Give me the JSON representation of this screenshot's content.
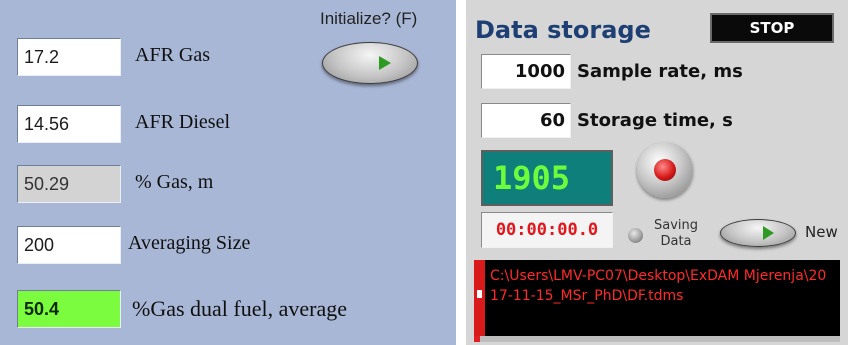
{
  "left": {
    "initialize_label": "Initialize? (F)",
    "afr_gas": {
      "value": "17.2",
      "label": "AFR Gas"
    },
    "afr_diesel": {
      "value": "14.56",
      "label": "AFR Diesel"
    },
    "gas_m": {
      "value": "50.29",
      "label": "% Gas, m"
    },
    "averaging_size": {
      "value": "200",
      "label": "Averaging Size"
    },
    "gas_dual_fuel_avg": {
      "value": "50.4",
      "label": "%Gas dual fuel, average"
    }
  },
  "right": {
    "title": "Data storage",
    "stop_label": "STOP",
    "sample_rate": {
      "value": "1000",
      "label": "Sample rate, ms"
    },
    "storage_time": {
      "value": "60",
      "label": "Storage time, s"
    },
    "counter": "1905",
    "timer": "00:00:00.0",
    "saving_label_line1": "Saving",
    "saving_label_line2": "Data",
    "new_label": "New",
    "file_path": "C:\\Users\\LMV-PC07\\Desktop\\ExDAM Mjerenja\\2017-11-15_MSr_PhD\\DF.tdms"
  },
  "colors": {
    "left_panel_bg": "#a9b7d6",
    "right_panel_bg": "#d6d6d6",
    "title_blue": "#1e3f73",
    "counter_bg": "#0e7f7a",
    "counter_text": "#6dfd3c",
    "timer_text": "#e3161b",
    "avg_indicator_bg": "#7cfc3f",
    "path_text": "#ff2a2a"
  },
  "icons": {
    "initialize_toggle": "pill-toggle-with-green-led",
    "new_toggle": "pill-toggle-with-green-led",
    "record_knob": "silver-knob-red-center",
    "saving_led": "grey-round-led"
  }
}
